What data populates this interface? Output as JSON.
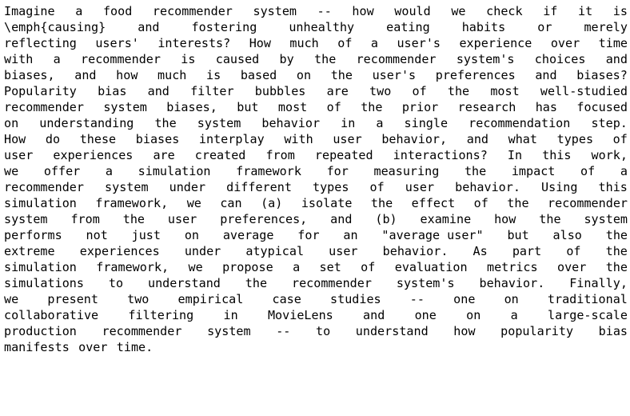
{
  "document": {
    "type": "abstract-text-block",
    "background_color": "#ffffff",
    "text_color": "#000000",
    "full_text": "Imagine a food recommender system -- how would we check if it is \\emph{causing} and fostering unhealthy eating habits or merely reflecting users' interests? How much of a user's experience over time with a recommender is caused by the recommender system's choices and biases, and how much is based on the user's preferences and biases? Popularity bias and filter bubbles are two of the most well-studied recommender system biases, but most of the prior research has focused on understanding the system behavior in a single recommendation step. How do these biases interplay with user behavior, and what types of user experiences are created from repeated interactions? In this work, we offer a simulation framework for measuring the impact of a recommender system under different types of user behavior. Using this simulation framework, we can (a) isolate the effect of the recommender system from the user preferences, and (b) examine how the system performs not just on average for an \"average user\" but also the extreme experiences under atypical user behavior. As part of the simulation framework, we propose a set of evaluation metrics over the simulations to understand the recommender system's behavior. Finally, we present two empirical case studies -- one on traditional collaborative filtering in MovieLens and one on a large-scale production recommender system -- to understand how popularity bias manifests over time.",
    "lines": [
      {
        "index": 1,
        "justified": true,
        "words": [
          "Imagine",
          "a",
          "food",
          "recommender",
          "system",
          "--",
          "how",
          "would",
          "we",
          "check",
          "if",
          "it",
          "is"
        ]
      },
      {
        "index": 2,
        "justified": true,
        "words": [
          "\\emph{causing}",
          "and",
          "fostering",
          "unhealthy",
          "eating",
          "habits",
          "or",
          "merely"
        ]
      },
      {
        "index": 3,
        "justified": true,
        "words": [
          "reflecting",
          "users'",
          "interests?",
          "How",
          "much",
          "of",
          "a",
          "user's",
          "experience",
          "over",
          "time"
        ]
      },
      {
        "index": 4,
        "justified": true,
        "words": [
          "with",
          "a",
          "recommender",
          "is",
          "caused",
          "by",
          "the",
          "recommender",
          "system's",
          "choices",
          "and"
        ]
      },
      {
        "index": 5,
        "justified": true,
        "words": [
          "biases,",
          "and",
          "how",
          "much",
          "is",
          "based",
          "on",
          "the",
          "user's",
          "preferences",
          "and",
          "biases?"
        ]
      },
      {
        "index": 6,
        "justified": true,
        "words": [
          "Popularity",
          "bias",
          "and",
          "filter",
          "bubbles",
          "are",
          "two",
          "of",
          "the",
          "most",
          "well-studied"
        ]
      },
      {
        "index": 7,
        "justified": true,
        "words": [
          "recommender",
          "system",
          "biases,",
          "but",
          "most",
          "of",
          "the",
          "prior",
          "research",
          "has",
          "focused"
        ]
      },
      {
        "index": 8,
        "justified": true,
        "words": [
          "on",
          "understanding",
          "the",
          "system",
          "behavior",
          "in",
          "a",
          "single",
          "recommendation",
          "step."
        ]
      },
      {
        "index": 9,
        "justified": true,
        "words": [
          "How",
          "do",
          "these",
          "biases",
          "interplay",
          "with",
          "user",
          "behavior,",
          "and",
          "what",
          "types",
          "of"
        ]
      },
      {
        "index": 10,
        "justified": true,
        "words": [
          "user",
          "experiences",
          "are",
          "created",
          "from",
          "repeated",
          "interactions?",
          "In",
          "this",
          "work,"
        ]
      },
      {
        "index": 11,
        "justified": true,
        "words": [
          "we",
          "offer",
          "a",
          "simulation",
          "framework",
          "for",
          "measuring",
          "the",
          "impact",
          "of",
          "a"
        ]
      },
      {
        "index": 12,
        "justified": true,
        "words": [
          "recommender",
          "system",
          "under",
          "different",
          "types",
          "of",
          "user",
          "behavior.",
          "Using",
          "this"
        ]
      },
      {
        "index": 13,
        "justified": true,
        "words": [
          "simulation",
          "framework,",
          "we",
          "can",
          "(a)",
          "isolate",
          "the",
          "effect",
          "of",
          "the",
          "recommender"
        ]
      },
      {
        "index": 14,
        "justified": true,
        "words": [
          "system",
          "from",
          "the",
          "user",
          "preferences,",
          "and",
          "(b)",
          "examine",
          "how",
          "the",
          "system"
        ]
      },
      {
        "index": 15,
        "justified": true,
        "words": [
          "performs",
          "not",
          "just",
          "on",
          "average",
          "for",
          "an",
          "\"average user\"",
          "but",
          "also",
          "the"
        ]
      },
      {
        "index": 16,
        "justified": true,
        "words": [
          "extreme",
          "experiences",
          "under",
          "atypical",
          "user",
          "behavior.",
          "As",
          "part",
          "of",
          "the"
        ]
      },
      {
        "index": 17,
        "justified": true,
        "words": [
          "simulation",
          "framework,",
          "we",
          "propose",
          "a",
          "set",
          "of",
          "evaluation",
          "metrics",
          "over",
          "the"
        ]
      },
      {
        "index": 18,
        "justified": true,
        "words": [
          "simulations",
          "to",
          "understand",
          "the",
          "recommender",
          "system's",
          "behavior.",
          "Finally,"
        ]
      },
      {
        "index": 19,
        "justified": true,
        "words": [
          "we",
          "present",
          "two",
          "empirical",
          "case",
          "studies",
          "--",
          "one",
          "on",
          "traditional"
        ]
      },
      {
        "index": 20,
        "justified": true,
        "words": [
          "collaborative",
          "filtering",
          "in",
          "MovieLens",
          "and",
          "one",
          "on",
          "a",
          "large-scale"
        ]
      },
      {
        "index": 21,
        "justified": true,
        "words": [
          "production",
          "recommender",
          "system",
          "--",
          "to",
          "understand",
          "how",
          "popularity",
          "bias"
        ]
      },
      {
        "index": 22,
        "justified": false,
        "words": [
          "manifests",
          "over",
          "time."
        ]
      }
    ]
  }
}
